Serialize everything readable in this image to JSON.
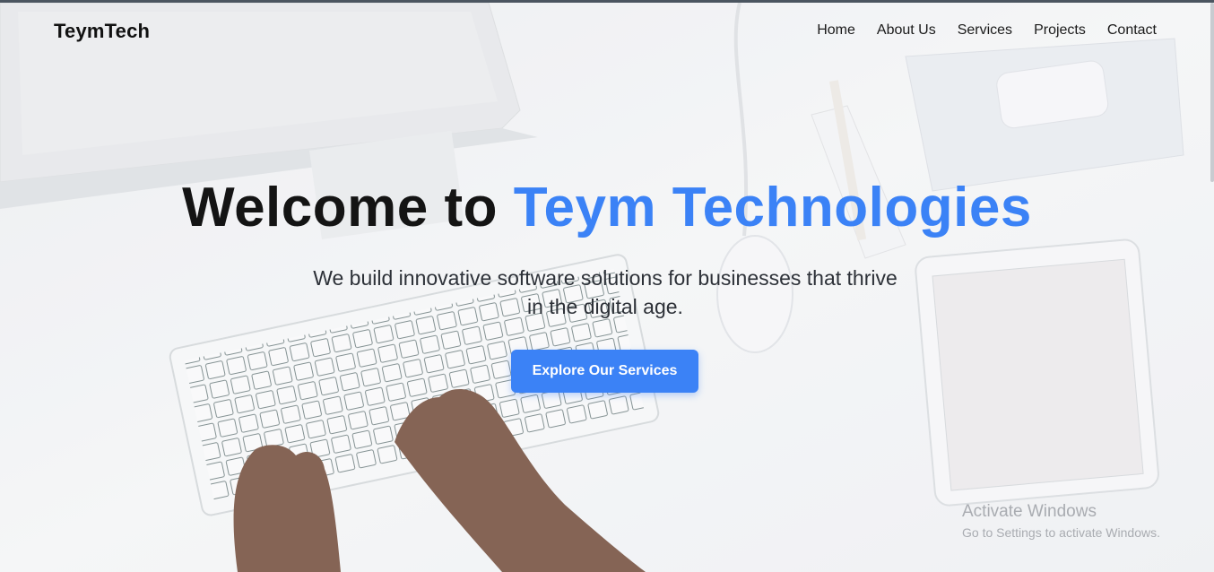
{
  "brand": {
    "name": "TeymTech"
  },
  "nav": {
    "items": [
      {
        "label": "Home"
      },
      {
        "label": "About Us"
      },
      {
        "label": "Services"
      },
      {
        "label": "Projects"
      },
      {
        "label": "Contact"
      }
    ]
  },
  "hero": {
    "title_lead": "Welcome to",
    "title_accent": "Teym Technologies",
    "subtitle": "We build innovative software solutions for businesses that thrive in the digital age.",
    "cta_label": "Explore Our Services"
  },
  "colors": {
    "accent": "#3b82f6",
    "text_dark": "#141414"
  },
  "os_overlay": {
    "line1": "Activate Windows",
    "line2": "Go to Settings to activate Windows."
  }
}
